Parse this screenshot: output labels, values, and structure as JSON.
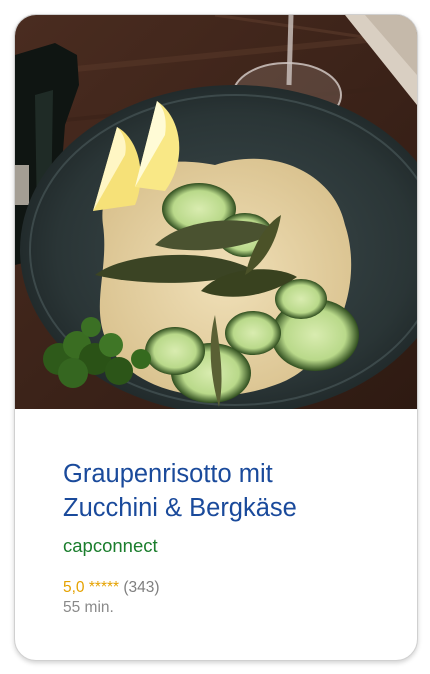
{
  "recipe": {
    "title_line1": "Graupenrisotto mit",
    "title_line2": "Zucchini & Bergkäse",
    "source": "capconnect",
    "rating": "5,0",
    "stars": "*****",
    "rating_count": "(343)",
    "duration": "55 min."
  },
  "colors": {
    "title": "#1a4a9b",
    "source": "#1a7d2c",
    "rating": "#e5a200",
    "meta": "#8a8a8a"
  }
}
